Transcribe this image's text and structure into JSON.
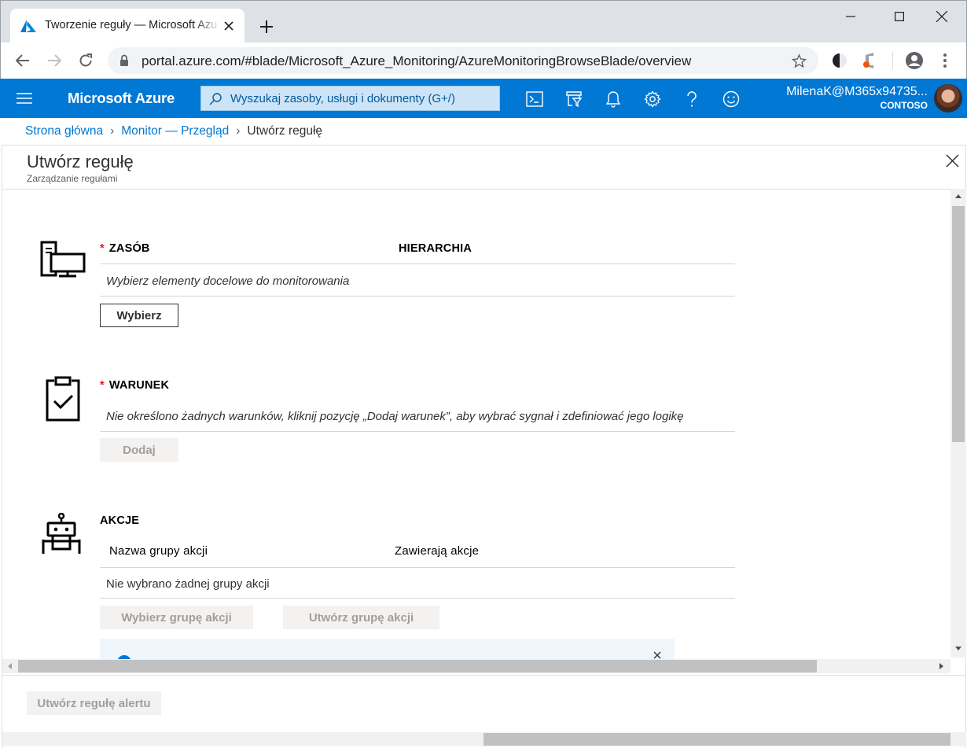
{
  "browser": {
    "tab_title": "Tworzenie reguły — Microsoft Azure",
    "url": "portal.azure.com/#blade/Microsoft_Azure_Monitoring/AzureMonitoringBrowseBlade/overview"
  },
  "azure": {
    "brand": "Microsoft Azure",
    "search_placeholder": "Wyszukaj zasoby, usługi i dokumenty (G+/)",
    "user_name": "MilenaK@M365x94735...",
    "tenant": "CONTOSO",
    "accent_color": "#0078d4"
  },
  "breadcrumb": {
    "home": "Strona główna",
    "monitor": "Monitor — Przegląd",
    "current": "Utwórz regułę"
  },
  "blade": {
    "title": "Utwórz regułę",
    "subtitle": "Zarządzanie regułami"
  },
  "resource": {
    "required_mark": "*",
    "label": "ZASÓB",
    "hierarchy_label": "HIERARCHIA",
    "empty_text": "Wybierz elementy docelowe do monitorowania",
    "select_button": "Wybierz"
  },
  "condition": {
    "required_mark": "*",
    "label": "WARUNEK",
    "empty_text": "Nie określono żadnych warunków, kliknij pozycję „Dodaj warunek”, aby wybrać sygnał i zdefiniować jego logikę",
    "add_button": "Dodaj"
  },
  "actions": {
    "label": "AKCJE",
    "col_group_name": "Nazwa grupy akcji",
    "col_contains": "Zawierają akcje",
    "empty_text": "Nie wybrano żadnej grupy akcji",
    "select_group_button": "Wybierz grupę akcji",
    "create_group_button": "Utwórz grupę akcji"
  },
  "footer": {
    "create_alert_button": "Utwórz regułę alertu"
  }
}
